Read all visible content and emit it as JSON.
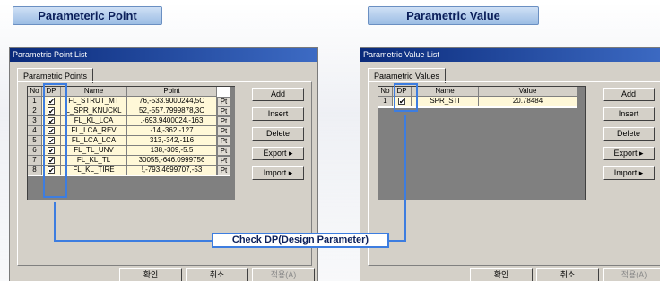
{
  "banners": {
    "left": "Parameteric Point",
    "right": "Parametric Value"
  },
  "left_dialog": {
    "title": "Parametric Point List",
    "tab": "Parametric Points",
    "columns": [
      "No",
      "DP",
      "Name",
      "Point"
    ],
    "rows": [
      {
        "no": "1",
        "checked": true,
        "name": "FL_STRUT_MT",
        "point": "76,-533.9000244,5C",
        "btn": "Pt"
      },
      {
        "no": "2",
        "checked": true,
        "name": "L_SPR_KNUCKL",
        "point": "52,-557.7999878,3C",
        "btn": "Pt"
      },
      {
        "no": "3",
        "checked": true,
        "name": "FL_KL_LCA",
        "point": ",-693.9400024,-163",
        "btn": "Pt"
      },
      {
        "no": "4",
        "checked": true,
        "name": "FL_LCA_REV",
        "point": "-14,-362,-127",
        "btn": "Pt"
      },
      {
        "no": "5",
        "checked": true,
        "name": "FL_LCA_LCA",
        "point": "313,-342,-116",
        "btn": "Pt"
      },
      {
        "no": "6",
        "checked": true,
        "name": "FL_TL_UNV",
        "point": "138,-309,-5.5",
        "btn": "Pt"
      },
      {
        "no": "7",
        "checked": true,
        "name": "FL_KL_TL",
        "point": "30055,-646.0999756",
        "btn": "Pt"
      },
      {
        "no": "8",
        "checked": true,
        "name": "FL_KL_TIRE",
        "point": "!,-793.4699707,-53",
        "btn": "Pt"
      }
    ],
    "buttons": {
      "add": "Add",
      "insert": "Insert",
      "delete": "Delete",
      "export": "Export  ▸",
      "import": "Import  ▸"
    },
    "footer": {
      "ok": "확인",
      "cancel": "취소",
      "apply": "적용(A)"
    }
  },
  "right_dialog": {
    "title": "Parametric Value List",
    "tab": "Parametric Values",
    "columns": [
      "No",
      "DP",
      "Name",
      "Value"
    ],
    "rows": [
      {
        "no": "1",
        "checked": true,
        "name": "SPR_STI",
        "value": "20.78484"
      }
    ],
    "buttons": {
      "add": "Add",
      "insert": "Insert",
      "delete": "Delete",
      "export": "Export  ▸",
      "import": "Import  ▸"
    },
    "footer": {
      "ok": "확인",
      "cancel": "취소",
      "apply": "적용(A)"
    }
  },
  "annotation": {
    "callout": "Check DP(Design Parameter)",
    "accent": "#3d7de0"
  },
  "icons": {
    "check": "✔"
  }
}
